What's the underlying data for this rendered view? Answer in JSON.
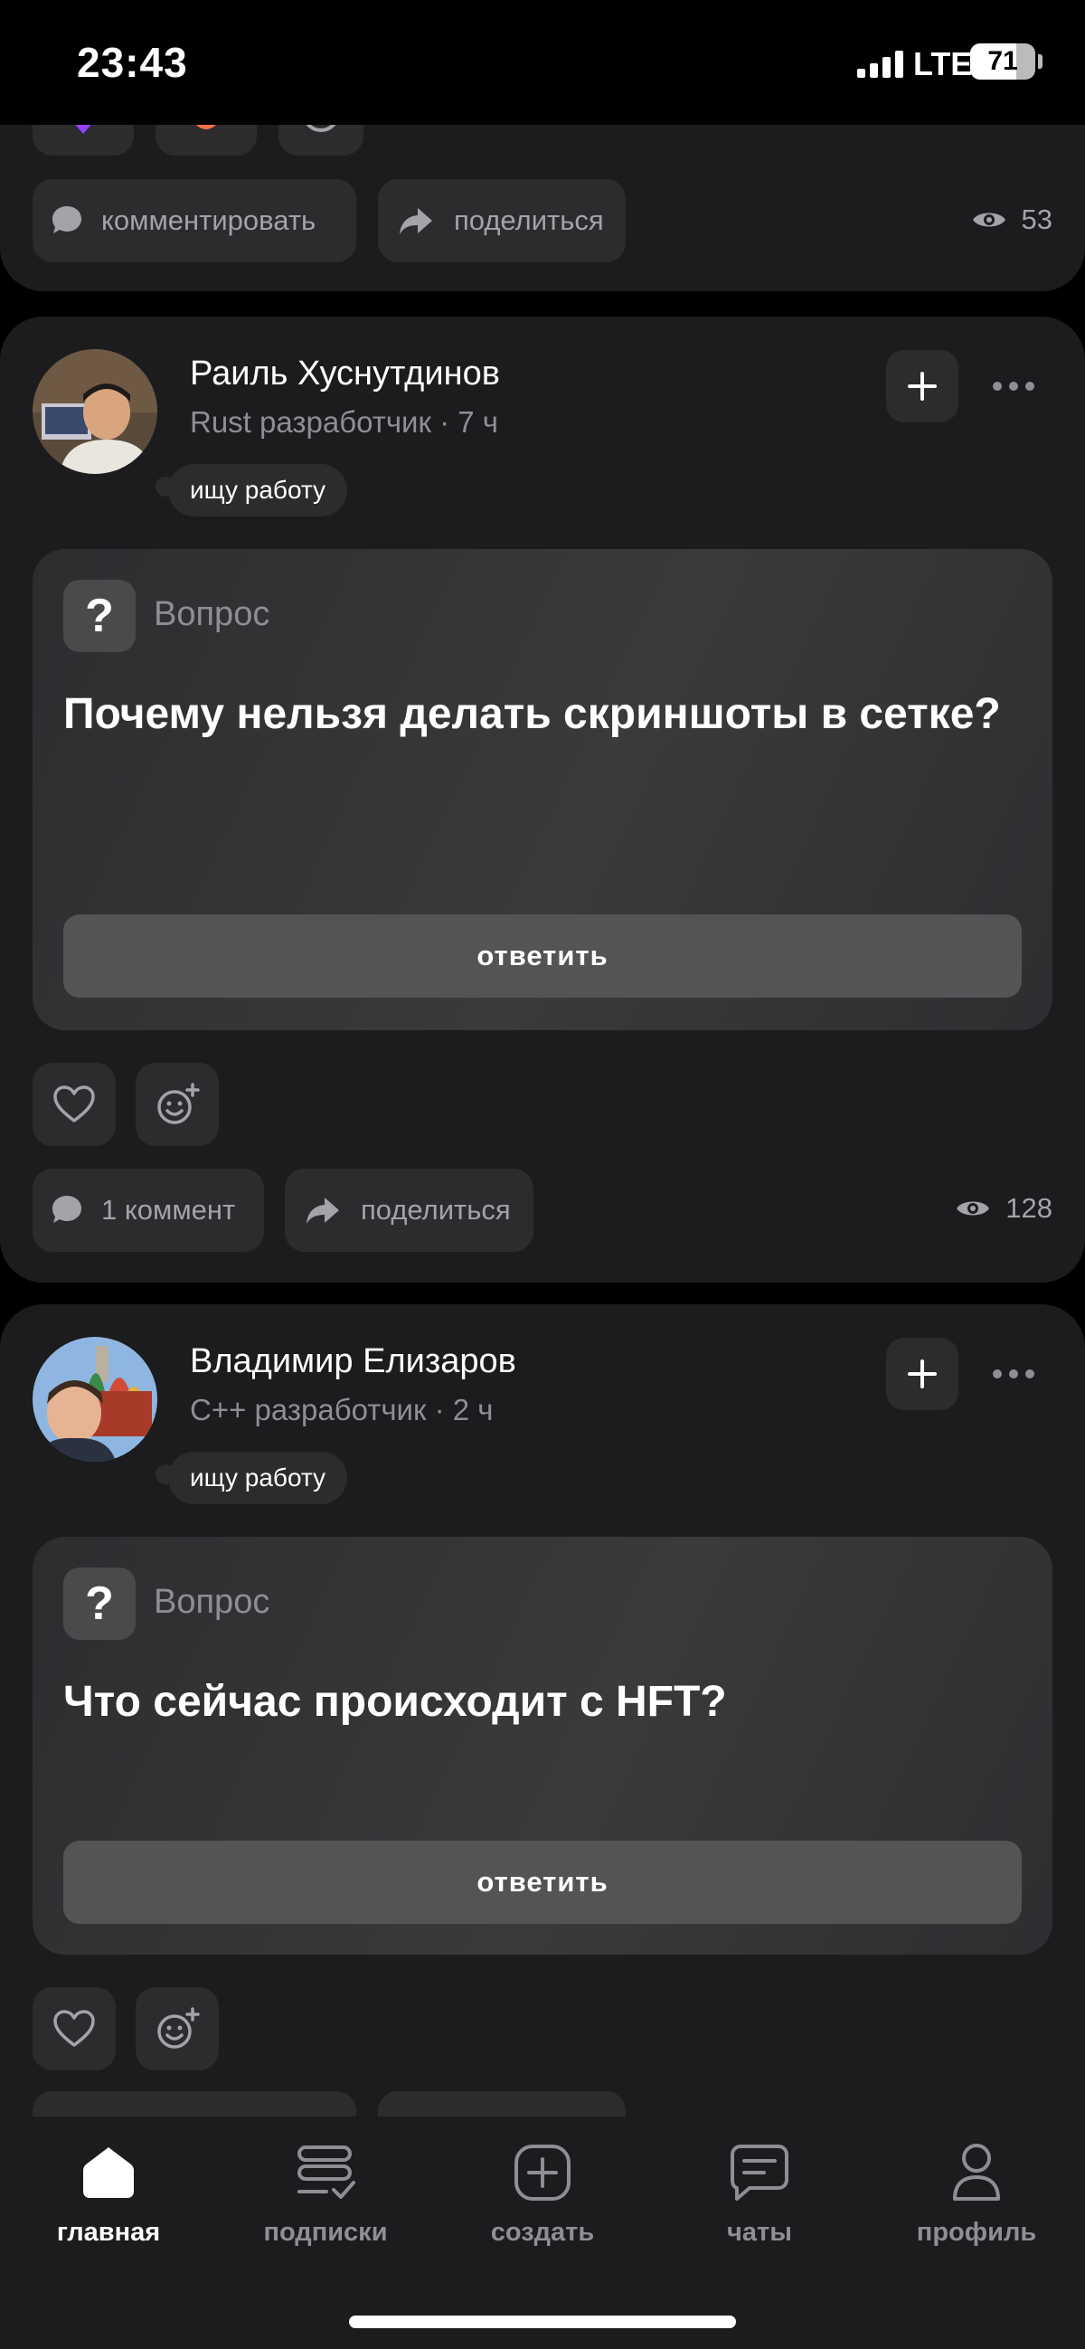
{
  "status_bar": {
    "time": "23:43",
    "network": "LTE",
    "battery": "71",
    "battery_level": 0.71
  },
  "top_card": {
    "comment_label": "комментировать",
    "share_label": "поделиться",
    "views": "53"
  },
  "posts": [
    {
      "author": "Раиль Хуснутдинов",
      "subtitle": "Rust разработчик · 7 ч",
      "status_tag": "ищу работу",
      "question_label": "Вопрос",
      "question_text": "Почему нельзя делать скриншоты в сетке?",
      "answer_label": "ответить",
      "comment_label": "1 коммент",
      "share_label": "поделиться",
      "views": "128"
    },
    {
      "author": "Владимир Елизаров",
      "subtitle": "C++ разработчик · 2 ч",
      "status_tag": "ищу работу",
      "question_label": "Вопрос",
      "question_text": "Что сейчас происходит с HFT?",
      "answer_label": "ответить"
    }
  ],
  "tabs": [
    {
      "label": "главная",
      "icon": "home-icon",
      "active": true
    },
    {
      "label": "подписки",
      "icon": "subscriptions-icon",
      "active": false
    },
    {
      "label": "создать",
      "icon": "plus-square-icon",
      "active": false
    },
    {
      "label": "чаты",
      "icon": "chat-icon",
      "active": false
    },
    {
      "label": "профиль",
      "icon": "person-icon",
      "active": false
    }
  ],
  "colors": {
    "background": "#000000",
    "card": "#1c1c1e",
    "button": "#2c2c2e",
    "muted_text": "#8e8e93"
  }
}
